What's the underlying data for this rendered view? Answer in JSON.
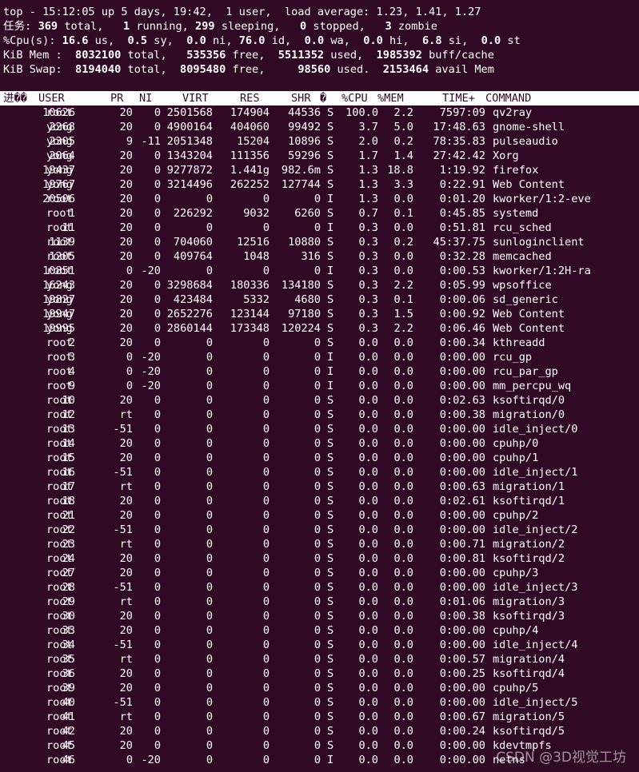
{
  "summary": {
    "line1": "top - 15:12:05 up 5 days, 19:42,  1 user,  load average: 1.23, 1.41, 1.27",
    "tasks": {
      "label": "任务:",
      "total": "369",
      "total_l": "total,",
      "running": "1",
      "running_l": "running,",
      "sleeping": "299",
      "sleeping_l": "sleeping,",
      "stopped": "0",
      "stopped_l": "stopped,",
      "zombie": "3",
      "zombie_l": "zombie"
    },
    "cpu": {
      "label": "%Cpu(s):",
      "us": "16.6",
      "us_l": "us,",
      "sy": "0.5",
      "sy_l": "sy,",
      "ni": "0.0",
      "ni_l": "ni,",
      "id": "76.0",
      "id_l": "id,",
      "wa": "0.0",
      "wa_l": "wa,",
      "hi": "0.0",
      "hi_l": "hi,",
      "si": "6.8",
      "si_l": "si,",
      "st": "0.0",
      "st_l": "st"
    },
    "mem": {
      "label": "KiB Mem :",
      "total": "8032100",
      "total_l": "total,",
      "free": "535356",
      "free_l": "free,",
      "used": "5511352",
      "used_l": "used,",
      "cache": "1985392",
      "cache_l": "buff/cache"
    },
    "swap": {
      "label": "KiB Swap:",
      "total": "8194040",
      "total_l": "total,",
      "free": "8095480",
      "free_l": "free,",
      "used": "98560",
      "used_l": "used.",
      "avail": "2153464",
      "avail_l": "avail Mem"
    }
  },
  "columns": [
    "进��",
    "USER",
    "PR",
    "NI",
    "VIRT",
    "RES",
    "SHR",
    "�",
    "%CPU",
    "%MEM",
    "TIME+",
    "COMMAND"
  ],
  "processes": [
    [
      "10626",
      "root",
      "20",
      "0",
      "2501568",
      "174904",
      "44536",
      "S",
      "100.0",
      "2.2",
      "7597:09",
      "qv2ray"
    ],
    [
      "2268",
      "yong",
      "20",
      "0",
      "4900164",
      "404060",
      "99492",
      "S",
      "3.7",
      "5.0",
      "17:48.63",
      "gnome-shell"
    ],
    [
      "2305",
      "yong",
      "9",
      "-11",
      "2051348",
      "15204",
      "10896",
      "S",
      "2.0",
      "0.2",
      "78:35.83",
      "pulseaudio"
    ],
    [
      "2064",
      "yong",
      "20",
      "0",
      "1343204",
      "111356",
      "59296",
      "S",
      "1.7",
      "1.4",
      "27:42.42",
      "Xorg"
    ],
    [
      "19437",
      "yong",
      "20",
      "0",
      "9277872",
      "1.441g",
      "982.6m",
      "S",
      "1.3",
      "18.8",
      "1:19.92",
      "firefox"
    ],
    [
      "19767",
      "yong",
      "20",
      "0",
      "3214496",
      "262252",
      "127744",
      "S",
      "1.3",
      "3.3",
      "0:22.91",
      "Web Content"
    ],
    [
      "20506",
      "root",
      "20",
      "0",
      "0",
      "0",
      "0",
      "I",
      "1.3",
      "0.0",
      "0:01.20",
      "kworker/1:2-eve"
    ],
    [
      "1",
      "root",
      "20",
      "0",
      "226292",
      "9032",
      "6260",
      "S",
      "0.7",
      "0.1",
      "0:45.85",
      "systemd"
    ],
    [
      "11",
      "root",
      "20",
      "0",
      "0",
      "0",
      "0",
      "I",
      "0.3",
      "0.0",
      "0:51.81",
      "rcu_sched"
    ],
    [
      "1139",
      "root",
      "20",
      "0",
      "704060",
      "12516",
      "10880",
      "S",
      "0.3",
      "0.2",
      "45:37.75",
      "sunloginclient"
    ],
    [
      "1205",
      "root",
      "20",
      "0",
      "409764",
      "1048",
      "316",
      "S",
      "0.3",
      "0.0",
      "0:32.28",
      "memcached"
    ],
    [
      "10851",
      "root",
      "0",
      "-20",
      "0",
      "0",
      "0",
      "I",
      "0.3",
      "0.0",
      "0:00.53",
      "kworker/1:2H-ra"
    ],
    [
      "16243",
      "yong",
      "20",
      "0",
      "3298684",
      "180336",
      "134180",
      "S",
      "0.3",
      "2.2",
      "0:05.99",
      "wpsoffice"
    ],
    [
      "19827",
      "yong",
      "20",
      "0",
      "423484",
      "5332",
      "4680",
      "S",
      "0.3",
      "0.1",
      "0:00.06",
      "sd_generic"
    ],
    [
      "19947",
      "yong",
      "20",
      "0",
      "2652276",
      "123144",
      "97180",
      "S",
      "0.3",
      "1.5",
      "0:00.92",
      "Web Content"
    ],
    [
      "19995",
      "yong",
      "20",
      "0",
      "2860144",
      "173348",
      "120224",
      "S",
      "0.3",
      "2.2",
      "0:06.46",
      "Web Content"
    ],
    [
      "2",
      "root",
      "20",
      "0",
      "0",
      "0",
      "0",
      "S",
      "0.0",
      "0.0",
      "0:00.34",
      "kthreadd"
    ],
    [
      "3",
      "root",
      "0",
      "-20",
      "0",
      "0",
      "0",
      "I",
      "0.0",
      "0.0",
      "0:00.00",
      "rcu_gp"
    ],
    [
      "4",
      "root",
      "0",
      "-20",
      "0",
      "0",
      "0",
      "I",
      "0.0",
      "0.0",
      "0:00.00",
      "rcu_par_gp"
    ],
    [
      "9",
      "root",
      "0",
      "-20",
      "0",
      "0",
      "0",
      "I",
      "0.0",
      "0.0",
      "0:00.00",
      "mm_percpu_wq"
    ],
    [
      "10",
      "root",
      "20",
      "0",
      "0",
      "0",
      "0",
      "S",
      "0.0",
      "0.0",
      "0:02.63",
      "ksoftirqd/0"
    ],
    [
      "12",
      "root",
      "rt",
      "0",
      "0",
      "0",
      "0",
      "S",
      "0.0",
      "0.0",
      "0:00.38",
      "migration/0"
    ],
    [
      "13",
      "root",
      "-51",
      "0",
      "0",
      "0",
      "0",
      "S",
      "0.0",
      "0.0",
      "0:00.00",
      "idle_inject/0"
    ],
    [
      "14",
      "root",
      "20",
      "0",
      "0",
      "0",
      "0",
      "S",
      "0.0",
      "0.0",
      "0:00.00",
      "cpuhp/0"
    ],
    [
      "15",
      "root",
      "20",
      "0",
      "0",
      "0",
      "0",
      "S",
      "0.0",
      "0.0",
      "0:00.00",
      "cpuhp/1"
    ],
    [
      "16",
      "root",
      "-51",
      "0",
      "0",
      "0",
      "0",
      "S",
      "0.0",
      "0.0",
      "0:00.00",
      "idle_inject/1"
    ],
    [
      "17",
      "root",
      "rt",
      "0",
      "0",
      "0",
      "0",
      "S",
      "0.0",
      "0.0",
      "0:00.63",
      "migration/1"
    ],
    [
      "18",
      "root",
      "20",
      "0",
      "0",
      "0",
      "0",
      "S",
      "0.0",
      "0.0",
      "0:02.61",
      "ksoftirqd/1"
    ],
    [
      "21",
      "root",
      "20",
      "0",
      "0",
      "0",
      "0",
      "S",
      "0.0",
      "0.0",
      "0:00.00",
      "cpuhp/2"
    ],
    [
      "22",
      "root",
      "-51",
      "0",
      "0",
      "0",
      "0",
      "S",
      "0.0",
      "0.0",
      "0:00.00",
      "idle_inject/2"
    ],
    [
      "23",
      "root",
      "rt",
      "0",
      "0",
      "0",
      "0",
      "S",
      "0.0",
      "0.0",
      "0:00.71",
      "migration/2"
    ],
    [
      "24",
      "root",
      "20",
      "0",
      "0",
      "0",
      "0",
      "S",
      "0.0",
      "0.0",
      "0:00.81",
      "ksoftirqd/2"
    ],
    [
      "27",
      "root",
      "20",
      "0",
      "0",
      "0",
      "0",
      "S",
      "0.0",
      "0.0",
      "0:00.00",
      "cpuhp/3"
    ],
    [
      "28",
      "root",
      "-51",
      "0",
      "0",
      "0",
      "0",
      "S",
      "0.0",
      "0.0",
      "0:00.00",
      "idle_inject/3"
    ],
    [
      "29",
      "root",
      "rt",
      "0",
      "0",
      "0",
      "0",
      "S",
      "0.0",
      "0.0",
      "0:01.06",
      "migration/3"
    ],
    [
      "30",
      "root",
      "20",
      "0",
      "0",
      "0",
      "0",
      "S",
      "0.0",
      "0.0",
      "0:00.38",
      "ksoftirqd/3"
    ],
    [
      "33",
      "root",
      "20",
      "0",
      "0",
      "0",
      "0",
      "S",
      "0.0",
      "0.0",
      "0:00.00",
      "cpuhp/4"
    ],
    [
      "34",
      "root",
      "-51",
      "0",
      "0",
      "0",
      "0",
      "S",
      "0.0",
      "0.0",
      "0:00.00",
      "idle_inject/4"
    ],
    [
      "35",
      "root",
      "rt",
      "0",
      "0",
      "0",
      "0",
      "S",
      "0.0",
      "0.0",
      "0:00.57",
      "migration/4"
    ],
    [
      "36",
      "root",
      "20",
      "0",
      "0",
      "0",
      "0",
      "S",
      "0.0",
      "0.0",
      "0:00.25",
      "ksoftirqd/4"
    ],
    [
      "39",
      "root",
      "20",
      "0",
      "0",
      "0",
      "0",
      "S",
      "0.0",
      "0.0",
      "0:00.00",
      "cpuhp/5"
    ],
    [
      "40",
      "root",
      "-51",
      "0",
      "0",
      "0",
      "0",
      "S",
      "0.0",
      "0.0",
      "0:00.00",
      "idle_inject/5"
    ],
    [
      "41",
      "root",
      "rt",
      "0",
      "0",
      "0",
      "0",
      "S",
      "0.0",
      "0.0",
      "0:00.67",
      "migration/5"
    ],
    [
      "42",
      "root",
      "20",
      "0",
      "0",
      "0",
      "0",
      "S",
      "0.0",
      "0.0",
      "0:00.24",
      "ksoftirqd/5"
    ],
    [
      "45",
      "root",
      "20",
      "0",
      "0",
      "0",
      "0",
      "S",
      "0.0",
      "0.0",
      "0:00.00",
      "kdevtmpfs"
    ],
    [
      "46",
      "root",
      "0",
      "-20",
      "0",
      "0",
      "0",
      "I",
      "0.0",
      "0.0",
      "0:00.00",
      "netns"
    ]
  ],
  "watermark": "CSDN @3D视觉工坊",
  "colors": {
    "background": "#300a24",
    "foreground": "#ffffff",
    "header_bg": "#ffffff",
    "header_fg": "#300a24"
  }
}
